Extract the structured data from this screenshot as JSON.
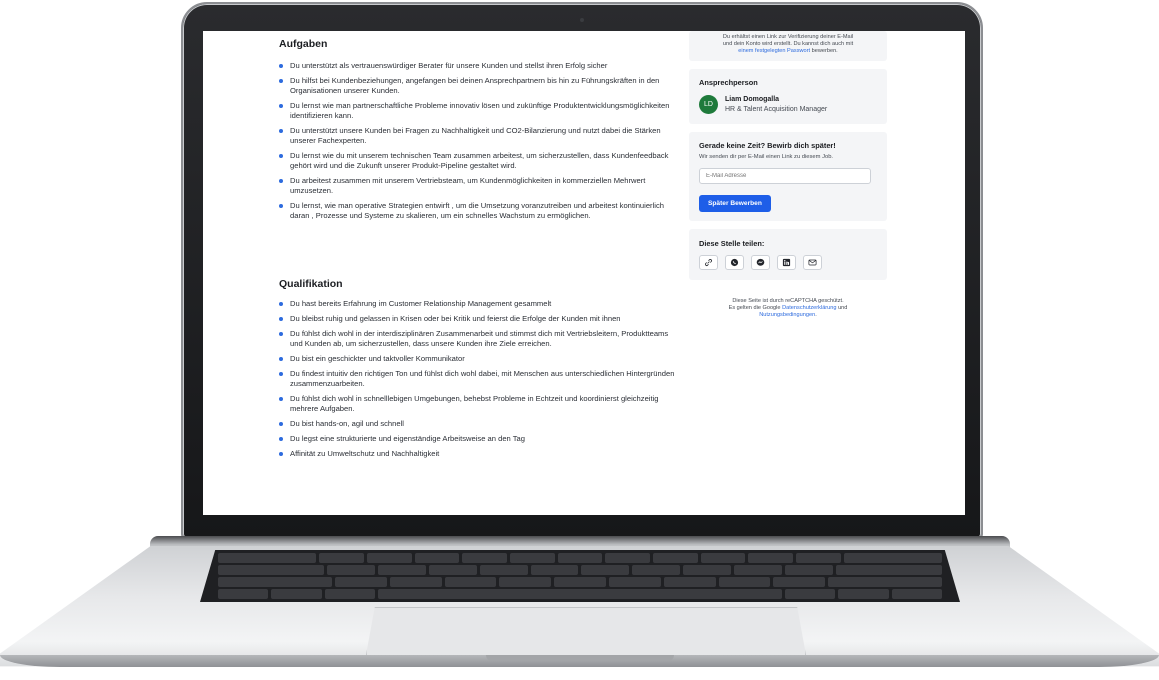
{
  "sidebar": {
    "verify_line1": "Du erhältst einen Link zur Verifizierung deiner E-Mail",
    "verify_line2": "und dein Konto wird erstellt. Du kannst dich auch mit",
    "verify_link": "einem festgelegten Passwort",
    "verify_after": " bewerben.",
    "contact": {
      "title": "Ansprechperson",
      "initials": "LD",
      "name": "Liam Domogalla",
      "role": "HR & Talent Acquisition Manager"
    },
    "apply_later": {
      "title": "Gerade keine Zeit? Bewirb dich später!",
      "subtitle": "Wir senden dir per E-Mail einen Link zu diesem Job.",
      "email_placeholder": "E-Mail Adresse",
      "button": "Später Bewerben"
    },
    "share": {
      "title": "Diese Stelle teilen:",
      "icons": [
        "link-icon",
        "whatsapp-icon",
        "messenger-icon",
        "linkedin-icon",
        "mail-icon"
      ]
    },
    "recaptcha": {
      "line1": "Diese Seite ist durch reCAPTCHA geschützt.",
      "line2": "Es gelten die Google ",
      "privacy": "Datenschutzerklärung",
      "und": " und",
      "terms": "Nutzungsbedingungen",
      "dot": "."
    }
  },
  "main": {
    "tasks_title": "Aufgaben",
    "tasks": [
      "Du unterstützt als vertrauenswürdiger Berater für unsere Kunden und stellst ihren Erfolg sicher",
      "Du hilfst bei Kundenbeziehungen, angefangen bei deinen Ansprechpartnern bis hin zu Führungskräften in den Organisationen unserer Kunden.",
      "Du lernst wie man partnerschaftliche Probleme innovativ lösen und zukünftige Produktentwicklungsmöglichkeiten identifizieren kann.",
      "Du unterstützt unsere Kunden bei Fragen zu Nachhaltigkeit und CO2-Bilanzierung und nutzt dabei die Stärken unserer Fachexperten.",
      "Du lernst wie du mit unserem technischen Team zusammen arbeitest, um sicherzustellen, dass Kundenfeedback gehört wird und die Zukunft unserer Produkt-Pipeline gestaltet wird.",
      "Du arbeitest zusammen mit unserem Vertriebsteam, um Kundenmöglichkeiten in kommerziellen Mehrwert umzusetzen.",
      "Du lernst, wie man operative Strategien entwirft , um die Umsetzung voranzutreiben und arbeitest kontinuierlich daran , Prozesse und Systeme zu skalieren, um ein schnelles Wachstum zu ermöglichen."
    ],
    "quals_title": "Qualifikation",
    "quals": [
      "Du hast bereits Erfahrung im Customer Relationship Management gesammelt",
      "Du bleibst ruhig und gelassen in Krisen oder bei Kritik und feierst die Erfolge der Kunden mit ihnen",
      "Du fühlst dich wohl in der interdisziplinären Zusammenarbeit und stimmst dich mit Vertriebsleitern, Produktteams und Kunden ab, um sicherzustellen, dass unsere Kunden ihre Ziele erreichen.",
      "Du bist ein geschickter und taktvoller Kommunikator",
      "Du findest intuitiv den richtigen Ton und fühlst dich wohl dabei, mit Menschen aus unterschiedlichen Hintergründen zusammenzuarbeiten.",
      "Du fühlst dich wohl in schnelllebigen Umgebungen, behebst Probleme in Echtzeit und koordinierst gleichzeitig mehrere Aufgaben.",
      "Du bist hands-on, agil und schnell",
      "Du legst eine strukturierte und eigenständige Arbeitsweise an den Tag",
      "Affinität zu Umweltschutz und Nachhaltigkeit"
    ]
  }
}
